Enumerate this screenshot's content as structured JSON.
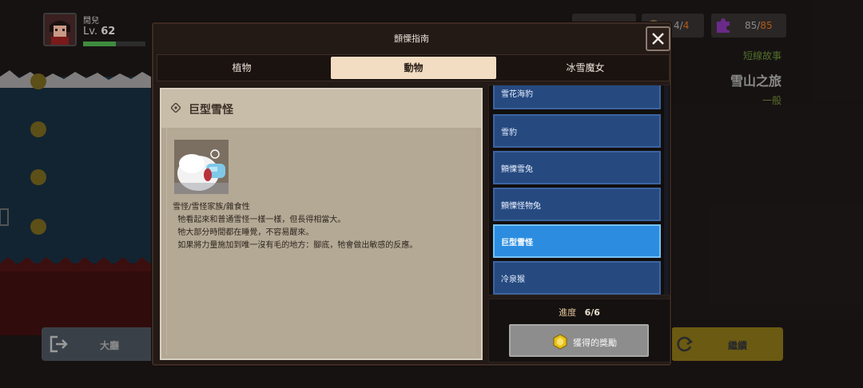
{
  "hud": {
    "player_name": "閒兒",
    "level_prefix": "Lv.",
    "level": "62",
    "xp_fraction": 0.52,
    "counter_a": {
      "current": "4",
      "separator": "/",
      "max": "4"
    },
    "counter_b": {
      "current": "85",
      "separator": "/",
      "max": "85"
    }
  },
  "side_panel": {
    "caption": "短線故事",
    "title": "雪山之旅",
    "difficulty": "一般"
  },
  "bottom_buttons": {
    "lobby_label": "大廳",
    "continue_label": "繼續"
  },
  "dialog": {
    "title": "顫慄指南",
    "tabs": [
      {
        "label": "植物",
        "active": false
      },
      {
        "label": "動物",
        "active": true
      },
      {
        "label": "冰雪魔女",
        "active": false
      }
    ],
    "detail": {
      "name": "巨型雪怪",
      "description": "雪怪/雪怪家族/雜食性\n  牠看起來和普通雪怪一樣一樣，但長得相當大。\n  牠大部分時間都在睡覺，不容易醒來。\n  如果將力量施加到唯一沒有毛的地方：腳底，牠會做出敏感的反應。"
    },
    "list": [
      {
        "label": "雪花海豹",
        "selected": false
      },
      {
        "label": "雪豹",
        "selected": false
      },
      {
        "label": "顫慄雪兔",
        "selected": false
      },
      {
        "label": "顫慄怪物兔",
        "selected": false
      },
      {
        "label": "巨型雪怪",
        "selected": true
      },
      {
        "label": "冷泉猴",
        "selected": false
      }
    ],
    "progress_label": "進度",
    "progress_value": "6/6",
    "reward_button_label": "獲得的獎勵"
  },
  "colors": {
    "selected_item": "#2c8de0",
    "list_item": "#264a80",
    "active_tab": "#f2dcc2",
    "progress_text": "#e2c69a"
  }
}
